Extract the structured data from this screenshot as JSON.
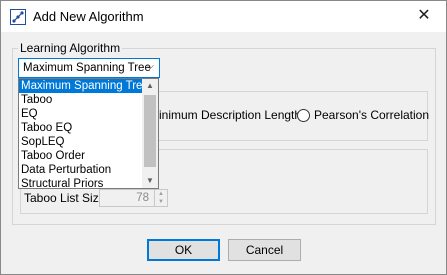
{
  "window": {
    "title": "Add New Algorithm",
    "close_glyph": "✕",
    "icon": "algorithm-app-icon"
  },
  "learning_group": {
    "title": "Learning Algorithm"
  },
  "algorithm_combo": {
    "selected": "Maximum Spanning Tree",
    "arrow_glyph": "⌵",
    "options": [
      "Maximum Spanning Tree",
      "Taboo",
      "EQ",
      "Taboo EQ",
      "SopLEQ",
      "Taboo Order",
      "Data Perturbation",
      "Structural Priors"
    ]
  },
  "score_options": {
    "mdl_label": "inimum Description Length",
    "pearson_label": "Pearson's Correlation"
  },
  "taboo": {
    "label": "Taboo List Size",
    "value": "78"
  },
  "buttons": {
    "ok": "OK",
    "cancel": "Cancel"
  },
  "colors": {
    "accent": "#0078d7",
    "window_bg": "#f0f0f0"
  }
}
